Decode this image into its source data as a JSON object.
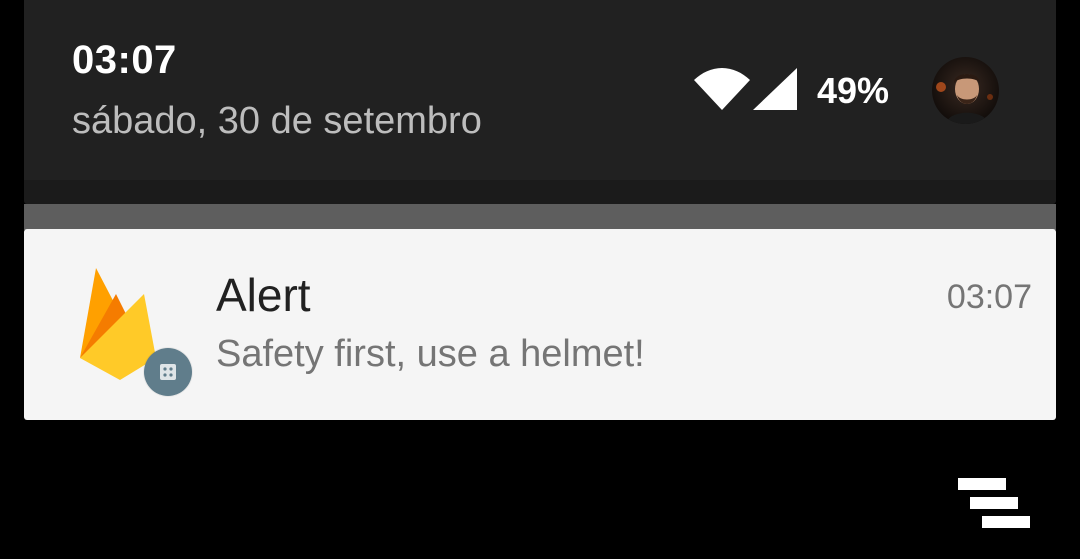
{
  "status_header": {
    "time": "03:07",
    "date": "sábado, 30 de setembro",
    "battery_percent": "49%",
    "icons": {
      "wifi": "wifi-icon",
      "signal": "cell-signal-icon",
      "avatar": "user-avatar"
    }
  },
  "notification": {
    "app_icon": "firebase-icon",
    "badge_icon": "app-badge-icon",
    "title": "Alert",
    "text": "Safety first, use a helmet!",
    "time": "03:07"
  },
  "overlay": {
    "watermark_icon": "stacked-bars-logo-icon"
  },
  "colors": {
    "panel_background": "#212121",
    "card_background": "#f5f5f5",
    "badge_color": "#607d8b",
    "firebase_yellow": "#ffca28",
    "firebase_orange": "#ffa000",
    "firebase_dark_orange": "#f57c00"
  }
}
